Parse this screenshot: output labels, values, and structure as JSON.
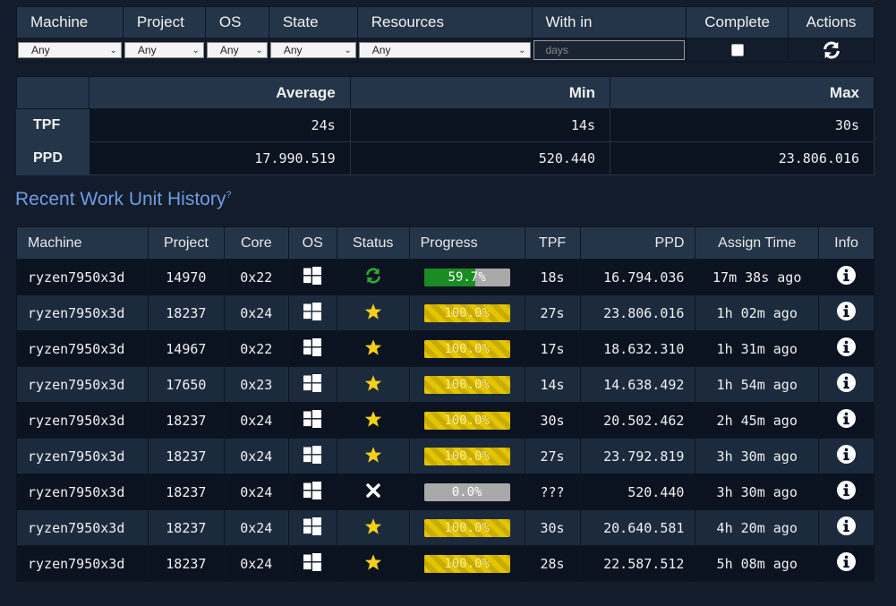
{
  "filters": {
    "headers": {
      "machine": "Machine",
      "project": "Project",
      "os": "OS",
      "state": "State",
      "resources": "Resources",
      "within": "With in",
      "complete": "Complete",
      "actions": "Actions"
    },
    "machine": "Any",
    "project": "Any",
    "os": "Any",
    "state": "Any",
    "resources": "Any",
    "days_placeholder": "days",
    "complete_checked": false
  },
  "stats": {
    "headers": {
      "average": "Average",
      "min": "Min",
      "max": "Max"
    },
    "rows": [
      {
        "label": "TPF",
        "average": "24s",
        "min": "14s",
        "max": "30s"
      },
      {
        "label": "PPD",
        "average": "17.990.519",
        "min": "520.440",
        "max": "23.806.016"
      }
    ]
  },
  "history": {
    "title": "Recent Work Unit History",
    "help_mark": "?",
    "headers": {
      "machine": "Machine",
      "project": "Project",
      "core": "Core",
      "os": "OS",
      "status": "Status",
      "progress": "Progress",
      "tpf": "TPF",
      "ppd": "PPD",
      "assign": "Assign Time",
      "info": "Info"
    },
    "rows": [
      {
        "machine": "ryzen7950x3d",
        "project": "14970",
        "core": "0x22",
        "os": "windows-icon",
        "status": "running",
        "progress": 59.7,
        "progress_label": "59.7%",
        "tpf": "18s",
        "ppd": "16.794.036",
        "assign": "17m 38s ago"
      },
      {
        "machine": "ryzen7950x3d",
        "project": "18237",
        "core": "0x24",
        "os": "windows-icon",
        "status": "finished",
        "progress": 100,
        "progress_label": "100.0%",
        "tpf": "27s",
        "ppd": "23.806.016",
        "assign": "1h 02m ago"
      },
      {
        "machine": "ryzen7950x3d",
        "project": "14967",
        "core": "0x22",
        "os": "windows-icon",
        "status": "finished",
        "progress": 100,
        "progress_label": "100.0%",
        "tpf": "17s",
        "ppd": "18.632.310",
        "assign": "1h 31m ago"
      },
      {
        "machine": "ryzen7950x3d",
        "project": "17650",
        "core": "0x23",
        "os": "windows-icon",
        "status": "finished",
        "progress": 100,
        "progress_label": "100.0%",
        "tpf": "14s",
        "ppd": "14.638.492",
        "assign": "1h 54m ago"
      },
      {
        "machine": "ryzen7950x3d",
        "project": "18237",
        "core": "0x24",
        "os": "windows-icon",
        "status": "finished",
        "progress": 100,
        "progress_label": "100.0%",
        "tpf": "30s",
        "ppd": "20.502.462",
        "assign": "2h 45m ago"
      },
      {
        "machine": "ryzen7950x3d",
        "project": "18237",
        "core": "0x24",
        "os": "windows-icon",
        "status": "finished",
        "progress": 100,
        "progress_label": "100.0%",
        "tpf": "27s",
        "ppd": "23.792.819",
        "assign": "3h 30m ago"
      },
      {
        "machine": "ryzen7950x3d",
        "project": "18237",
        "core": "0x24",
        "os": "windows-icon",
        "status": "failed",
        "progress": 0,
        "progress_label": "0.0%",
        "tpf": "???",
        "ppd": "520.440",
        "assign": "3h 30m ago"
      },
      {
        "machine": "ryzen7950x3d",
        "project": "18237",
        "core": "0x24",
        "os": "windows-icon",
        "status": "finished",
        "progress": 100,
        "progress_label": "100.0%",
        "tpf": "30s",
        "ppd": "20.640.581",
        "assign": "4h 20m ago"
      },
      {
        "machine": "ryzen7950x3d",
        "project": "18237",
        "core": "0x24",
        "os": "windows-icon",
        "status": "finished",
        "progress": 100,
        "progress_label": "100.0%",
        "tpf": "28s",
        "ppd": "22.587.512",
        "assign": "5h 08m ago"
      }
    ]
  },
  "colors": {
    "header_bg": "#253549",
    "page_bg": "#131c2b",
    "title": "#6f9de3",
    "progress_green": "#1a8c22",
    "progress_yellow": "#e4c400",
    "star": "#f5cf1a",
    "running": "#2fa836"
  }
}
